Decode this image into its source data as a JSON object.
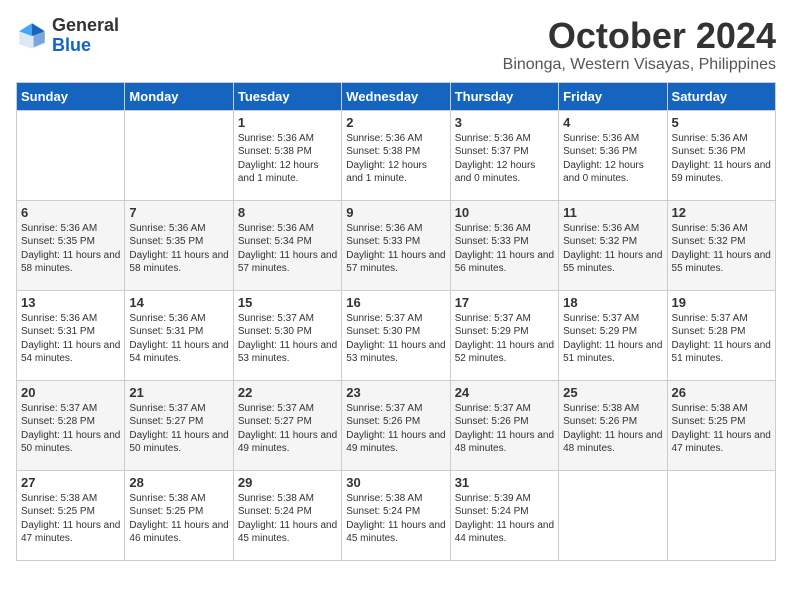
{
  "logo": {
    "general": "General",
    "blue": "Blue"
  },
  "title": "October 2024",
  "location": "Binonga, Western Visayas, Philippines",
  "headers": [
    "Sunday",
    "Monday",
    "Tuesday",
    "Wednesday",
    "Thursday",
    "Friday",
    "Saturday"
  ],
  "weeks": [
    [
      {
        "day": "",
        "info": ""
      },
      {
        "day": "",
        "info": ""
      },
      {
        "day": "1",
        "info": "Sunrise: 5:36 AM\nSunset: 5:38 PM\nDaylight: 12 hours\nand 1 minute."
      },
      {
        "day": "2",
        "info": "Sunrise: 5:36 AM\nSunset: 5:38 PM\nDaylight: 12 hours\nand 1 minute."
      },
      {
        "day": "3",
        "info": "Sunrise: 5:36 AM\nSunset: 5:37 PM\nDaylight: 12 hours\nand 0 minutes."
      },
      {
        "day": "4",
        "info": "Sunrise: 5:36 AM\nSunset: 5:36 PM\nDaylight: 12 hours\nand 0 minutes."
      },
      {
        "day": "5",
        "info": "Sunrise: 5:36 AM\nSunset: 5:36 PM\nDaylight: 11 hours\nand 59 minutes."
      }
    ],
    [
      {
        "day": "6",
        "info": "Sunrise: 5:36 AM\nSunset: 5:35 PM\nDaylight: 11 hours\nand 58 minutes."
      },
      {
        "day": "7",
        "info": "Sunrise: 5:36 AM\nSunset: 5:35 PM\nDaylight: 11 hours\nand 58 minutes."
      },
      {
        "day": "8",
        "info": "Sunrise: 5:36 AM\nSunset: 5:34 PM\nDaylight: 11 hours\nand 57 minutes."
      },
      {
        "day": "9",
        "info": "Sunrise: 5:36 AM\nSunset: 5:33 PM\nDaylight: 11 hours\nand 57 minutes."
      },
      {
        "day": "10",
        "info": "Sunrise: 5:36 AM\nSunset: 5:33 PM\nDaylight: 11 hours\nand 56 minutes."
      },
      {
        "day": "11",
        "info": "Sunrise: 5:36 AM\nSunset: 5:32 PM\nDaylight: 11 hours\nand 55 minutes."
      },
      {
        "day": "12",
        "info": "Sunrise: 5:36 AM\nSunset: 5:32 PM\nDaylight: 11 hours\nand 55 minutes."
      }
    ],
    [
      {
        "day": "13",
        "info": "Sunrise: 5:36 AM\nSunset: 5:31 PM\nDaylight: 11 hours\nand 54 minutes."
      },
      {
        "day": "14",
        "info": "Sunrise: 5:36 AM\nSunset: 5:31 PM\nDaylight: 11 hours\nand 54 minutes."
      },
      {
        "day": "15",
        "info": "Sunrise: 5:37 AM\nSunset: 5:30 PM\nDaylight: 11 hours\nand 53 minutes."
      },
      {
        "day": "16",
        "info": "Sunrise: 5:37 AM\nSunset: 5:30 PM\nDaylight: 11 hours\nand 53 minutes."
      },
      {
        "day": "17",
        "info": "Sunrise: 5:37 AM\nSunset: 5:29 PM\nDaylight: 11 hours\nand 52 minutes."
      },
      {
        "day": "18",
        "info": "Sunrise: 5:37 AM\nSunset: 5:29 PM\nDaylight: 11 hours\nand 51 minutes."
      },
      {
        "day": "19",
        "info": "Sunrise: 5:37 AM\nSunset: 5:28 PM\nDaylight: 11 hours\nand 51 minutes."
      }
    ],
    [
      {
        "day": "20",
        "info": "Sunrise: 5:37 AM\nSunset: 5:28 PM\nDaylight: 11 hours\nand 50 minutes."
      },
      {
        "day": "21",
        "info": "Sunrise: 5:37 AM\nSunset: 5:27 PM\nDaylight: 11 hours\nand 50 minutes."
      },
      {
        "day": "22",
        "info": "Sunrise: 5:37 AM\nSunset: 5:27 PM\nDaylight: 11 hours\nand 49 minutes."
      },
      {
        "day": "23",
        "info": "Sunrise: 5:37 AM\nSunset: 5:26 PM\nDaylight: 11 hours\nand 49 minutes."
      },
      {
        "day": "24",
        "info": "Sunrise: 5:37 AM\nSunset: 5:26 PM\nDaylight: 11 hours\nand 48 minutes."
      },
      {
        "day": "25",
        "info": "Sunrise: 5:38 AM\nSunset: 5:26 PM\nDaylight: 11 hours\nand 48 minutes."
      },
      {
        "day": "26",
        "info": "Sunrise: 5:38 AM\nSunset: 5:25 PM\nDaylight: 11 hours\nand 47 minutes."
      }
    ],
    [
      {
        "day": "27",
        "info": "Sunrise: 5:38 AM\nSunset: 5:25 PM\nDaylight: 11 hours\nand 47 minutes."
      },
      {
        "day": "28",
        "info": "Sunrise: 5:38 AM\nSunset: 5:25 PM\nDaylight: 11 hours\nand 46 minutes."
      },
      {
        "day": "29",
        "info": "Sunrise: 5:38 AM\nSunset: 5:24 PM\nDaylight: 11 hours\nand 45 minutes."
      },
      {
        "day": "30",
        "info": "Sunrise: 5:38 AM\nSunset: 5:24 PM\nDaylight: 11 hours\nand 45 minutes."
      },
      {
        "day": "31",
        "info": "Sunrise: 5:39 AM\nSunset: 5:24 PM\nDaylight: 11 hours\nand 44 minutes."
      },
      {
        "day": "",
        "info": ""
      },
      {
        "day": "",
        "info": ""
      }
    ]
  ]
}
